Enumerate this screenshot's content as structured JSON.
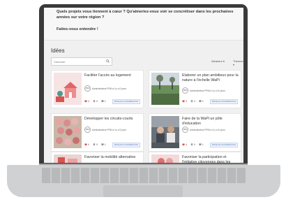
{
  "intro": {
    "question": "Quels projets vous tiennent à cœur ? Qu'aimeriez-vous voir se concrétiser dans les prochaines années sur votre région ?",
    "cta": "Faites-vous entendre !"
  },
  "section_title": "Idées",
  "search": {
    "placeholder": "Chercher"
  },
  "filters": [
    "Aléatoire",
    "Thèmes"
  ],
  "cards": [
    {
      "title": "Faciliter l'accès au logement",
      "author": "Administrateur PRM",
      "meta": "a il y a 9 jours",
      "likes": "4",
      "dislikes": "0",
      "comments": "1",
      "tag": "PRISE EN CONSIDÉRATION"
    },
    {
      "title": "Elaborer un plan ambitieux pour la nature à l'échelle WaPi",
      "author": "Administrateur PRM",
      "meta": "a il y a 10 jours",
      "likes": "4",
      "dislikes": "0",
      "comments": "1",
      "tag": "PRISE EN CONSIDÉRATION"
    },
    {
      "title": "Développer les circuits-courts",
      "author": "Administrateur PRM",
      "meta": "a il y a 9 jours",
      "likes": "4",
      "dislikes": "0",
      "comments": "1",
      "tag": "PRISE EN CONSIDÉRATION"
    },
    {
      "title": "Faire de la WaPi un pôle d'éducation",
      "author": "Administrateur PRM",
      "meta": "a il y a 10 jours",
      "likes": "4",
      "dislikes": "0",
      "comments": "1",
      "tag": "PRISE EN CONSIDÉRATION"
    },
    {
      "title": "Favoriser la mobilité alternative",
      "author": "",
      "meta": "",
      "likes": "",
      "dislikes": "",
      "comments": "",
      "tag": ""
    },
    {
      "title": "Favoriser la participation et l'initiative citoyennes dans les projets",
      "author": "",
      "meta": "",
      "likes": "",
      "dislikes": "",
      "comments": "",
      "tag": ""
    }
  ],
  "avatar_text": "PRM",
  "colors": {
    "tag_blue": "#5a7bbf",
    "heart_red": "#d9534f",
    "screen_bezel": "#3a3a3a",
    "laptop_body": "#cfd1d3"
  }
}
